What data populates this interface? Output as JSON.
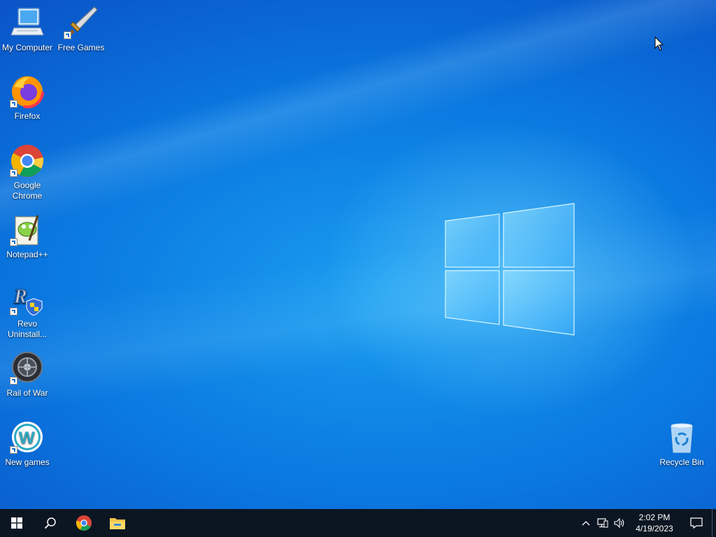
{
  "desktop": {
    "icons": [
      {
        "label": "My Computer",
        "icon": "computer-icon"
      },
      {
        "label": "Free Games",
        "icon": "sword-icon"
      },
      {
        "label": "Firefox",
        "icon": "firefox-icon"
      },
      {
        "label": "Google Chrome",
        "icon": "chrome-icon"
      },
      {
        "label": "Notepad++",
        "icon": "notepadpp-icon"
      },
      {
        "label": "Revo Uninstall...",
        "icon": "revo-uninstaller-icon"
      },
      {
        "label": "Rail of War",
        "icon": "rail-of-war-icon"
      },
      {
        "label": "New games",
        "icon": "new-games-icon"
      },
      {
        "label": "Recycle Bin",
        "icon": "recycle-bin-icon"
      }
    ]
  },
  "taskbar": {
    "start": "windows-start-icon",
    "search": "search-icon",
    "pinned": [
      "chrome-icon",
      "file-explorer-icon"
    ],
    "tray": {
      "icons": [
        "chevron-up-icon",
        "network-icon",
        "volume-icon"
      ],
      "time": "2:02 PM",
      "date": "4/19/2023",
      "notifications": "action-center-icon"
    }
  },
  "colors": {
    "taskbar": "#0c1622",
    "desktop_blue": "#0a78e0"
  }
}
